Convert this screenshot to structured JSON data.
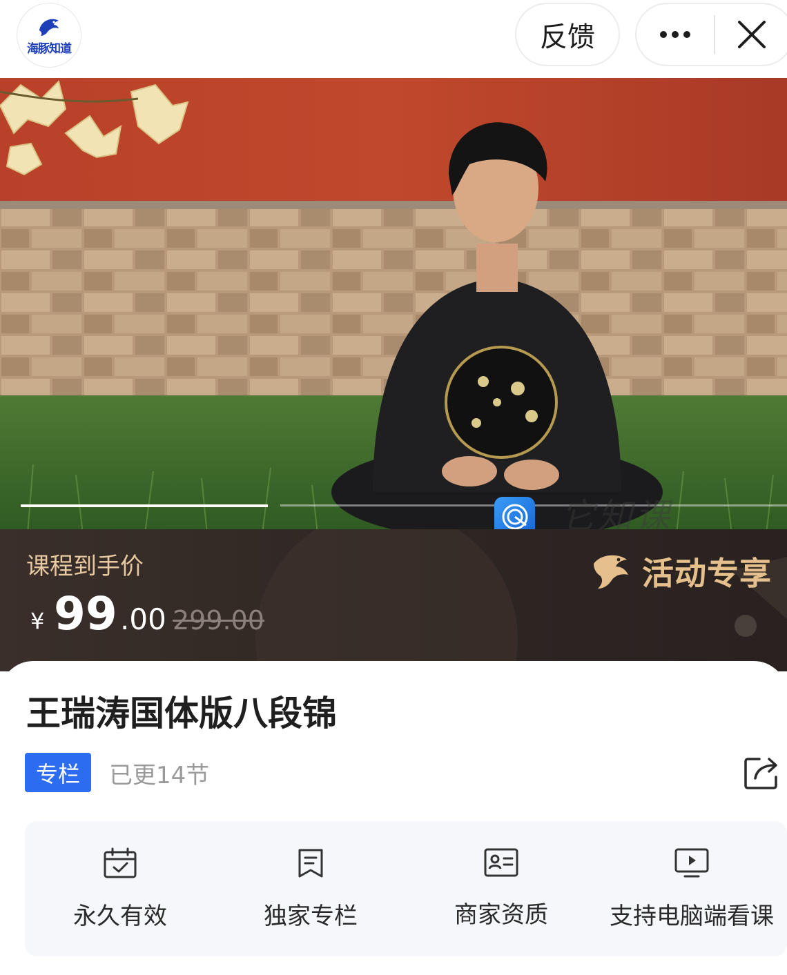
{
  "topbar": {
    "logo_text": "海豚知道",
    "feedback_label": "反馈",
    "menu_icon": "more-dots-icon",
    "close_icon": "close-icon"
  },
  "hero": {
    "watermark_text": "它知课",
    "carousel_slide_count": 2,
    "carousel_active_index": 1
  },
  "price": {
    "label": "课程到手价",
    "currency": "¥",
    "integer": "99",
    "decimal": ".00",
    "original": "299.00",
    "promo_text": "活动专享"
  },
  "course": {
    "title": "王瑞涛国体版八段锦",
    "tag": "专栏",
    "updated": "已更14节",
    "share_icon": "share-icon"
  },
  "features": [
    {
      "icon": "calendar-check-icon",
      "label": "永久有效"
    },
    {
      "icon": "bookmark-icon",
      "label": "独家专栏"
    },
    {
      "icon": "id-card-icon",
      "label": "商家资质"
    },
    {
      "icon": "monitor-play-icon",
      "label": "支持电脑端看课"
    }
  ],
  "colors": {
    "accent_blue": "#2b6cf0",
    "price_band": "#2e2623",
    "promo_gold": "#e6c08c"
  }
}
